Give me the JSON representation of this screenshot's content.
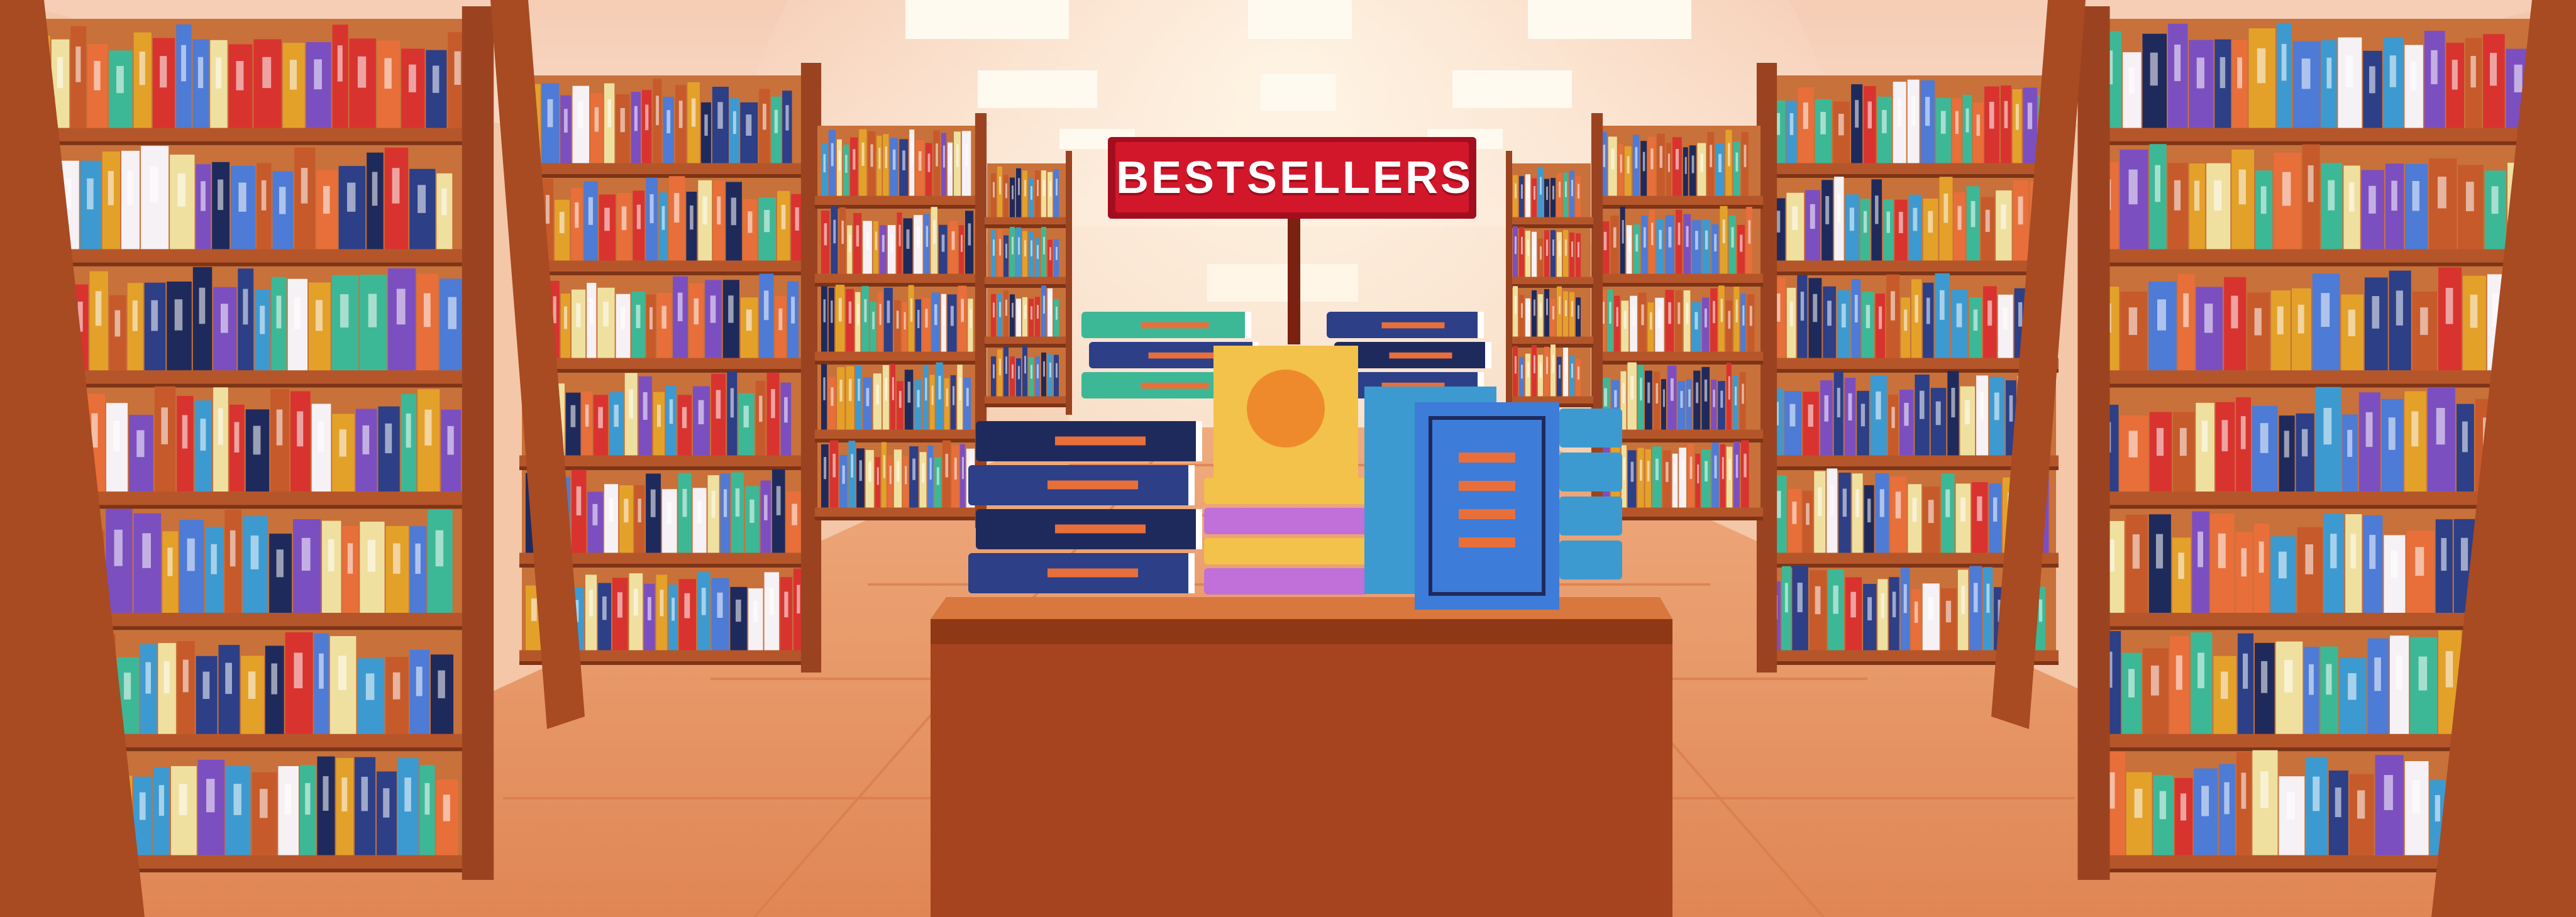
{
  "sign": {
    "text": "BESTSELLERS"
  },
  "colors": {
    "wall": "#f4cdb2",
    "ceiling": "#f8d6c1",
    "light": "#fff9ee",
    "floor": "#e59263",
    "floor_tile_light": "#eea476",
    "shelf_wood": "#b5562a",
    "shelf_wood_dark": "#7d3417",
    "shelf_back": "#c8713a",
    "table_top": "#d8773e",
    "table_front": "#a6441f",
    "sign_red": "#d3172b",
    "sign_border": "#a30e1f",
    "sign_pole": "#7b2112"
  },
  "book_palette": [
    "#2c3f87",
    "#e3a12a",
    "#d9332f",
    "#3d9ad0",
    "#7c4fc0",
    "#3db896",
    "#f0e0a0",
    "#c75a2a",
    "#1f2a5c",
    "#e86f3a",
    "#f6f1f4",
    "#4d7bd6"
  ]
}
